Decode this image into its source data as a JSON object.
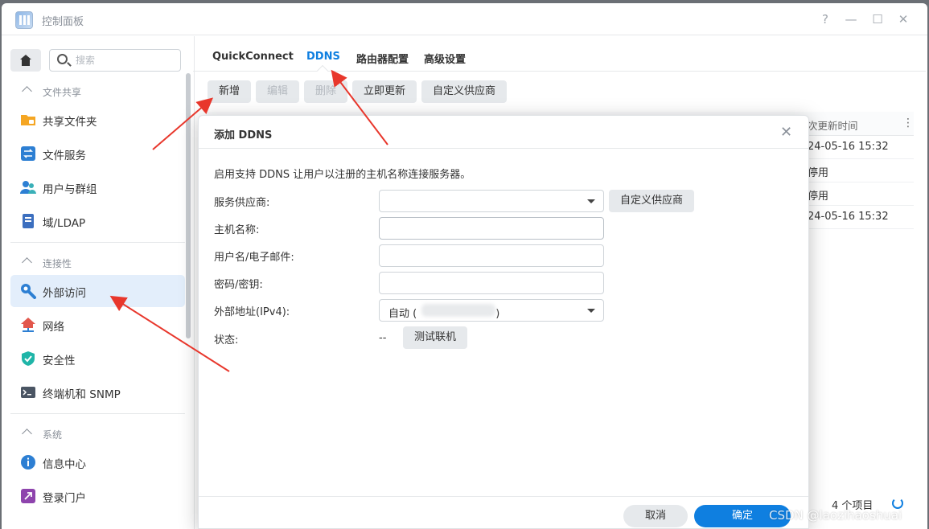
{
  "window": {
    "title": "控制面板",
    "controls": [
      "?",
      "—",
      "☐",
      "✕"
    ]
  },
  "sidebar": {
    "search_placeholder": "搜索",
    "sections": [
      {
        "label": "文件共享",
        "items": [
          {
            "label": "共享文件夹",
            "icon": "shared-folder-icon"
          },
          {
            "label": "文件服务",
            "icon": "file-services-icon"
          },
          {
            "label": "用户与群组",
            "icon": "users-icon"
          },
          {
            "label": "域/LDAP",
            "icon": "domain-icon"
          }
        ]
      },
      {
        "label": "连接性",
        "items": [
          {
            "label": "外部访问",
            "icon": "external-access-icon",
            "active": true
          },
          {
            "label": "网络",
            "icon": "network-icon"
          },
          {
            "label": "安全性",
            "icon": "security-shield-icon"
          },
          {
            "label": "终端机和 SNMP",
            "icon": "terminal-icon"
          }
        ]
      },
      {
        "label": "系统",
        "items": [
          {
            "label": "信息中心",
            "icon": "info-icon"
          },
          {
            "label": "登录门户",
            "icon": "login-portal-icon"
          }
        ]
      }
    ]
  },
  "tabs": [
    {
      "label": "QuickConnect"
    },
    {
      "label": "DDNS",
      "active": true
    },
    {
      "label": "路由器配置"
    },
    {
      "label": "高级设置"
    }
  ],
  "toolbar": {
    "add": "新增",
    "edit": "编辑",
    "delete": "删除",
    "update_now": "立即更新",
    "custom_provider": "自定义供应商"
  },
  "table": {
    "column_last_update": "次更新时间",
    "rows": [
      "24-05-16 15:32",
      "停用",
      "停用",
      "24-05-16 15:32"
    ],
    "count": "4 个项目"
  },
  "modal": {
    "title": "添加 DDNS",
    "description": "启用支持 DDNS 让用户以注册的主机名称连接服务器。",
    "fields": {
      "provider_label": "服务供应商:",
      "provider_value": "",
      "custom_provider_btn": "自定义供应商",
      "hostname_label": "主机名称:",
      "username_label": "用户名/电子邮件:",
      "password_label": "密码/密钥:",
      "external_addr_label": "外部地址(IPv4):",
      "external_addr_prefix": "自动 (",
      "external_addr_suffix": ")",
      "status_label": "状态:",
      "status_value": "--",
      "test_btn": "测试联机"
    },
    "cancel": "取消",
    "ok": "确定"
  },
  "watermark": "CSDN @laozihaoshuai",
  "colors": {
    "accent": "#0f7fe0",
    "annotation_arrow": "#e8372c",
    "active_nav_bg": "#e3eefb"
  }
}
